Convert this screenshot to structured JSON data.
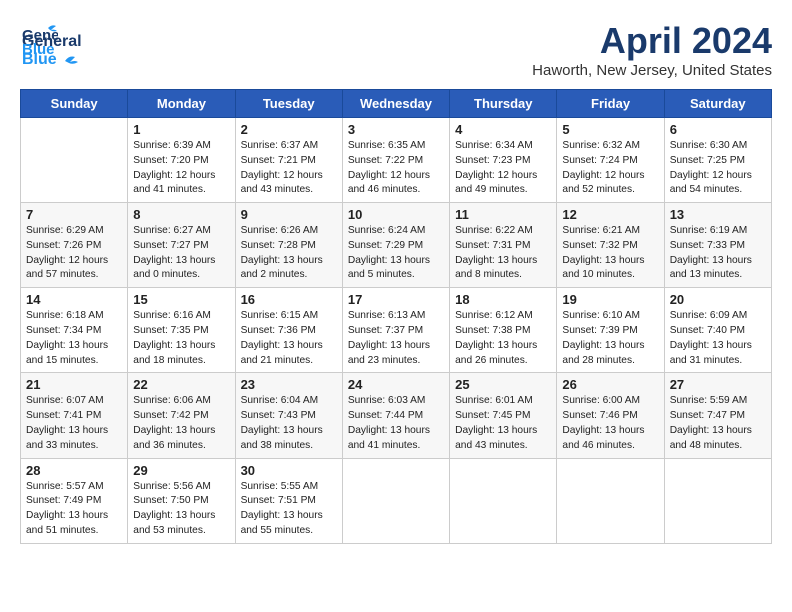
{
  "header": {
    "logo_general": "General",
    "logo_blue": "Blue",
    "month_title": "April 2024",
    "location": "Haworth, New Jersey, United States"
  },
  "columns": [
    "Sunday",
    "Monday",
    "Tuesday",
    "Wednesday",
    "Thursday",
    "Friday",
    "Saturday"
  ],
  "weeks": [
    [
      {
        "day": "",
        "info": ""
      },
      {
        "day": "1",
        "info": "Sunrise: 6:39 AM\nSunset: 7:20 PM\nDaylight: 12 hours\nand 41 minutes."
      },
      {
        "day": "2",
        "info": "Sunrise: 6:37 AM\nSunset: 7:21 PM\nDaylight: 12 hours\nand 43 minutes."
      },
      {
        "day": "3",
        "info": "Sunrise: 6:35 AM\nSunset: 7:22 PM\nDaylight: 12 hours\nand 46 minutes."
      },
      {
        "day": "4",
        "info": "Sunrise: 6:34 AM\nSunset: 7:23 PM\nDaylight: 12 hours\nand 49 minutes."
      },
      {
        "day": "5",
        "info": "Sunrise: 6:32 AM\nSunset: 7:24 PM\nDaylight: 12 hours\nand 52 minutes."
      },
      {
        "day": "6",
        "info": "Sunrise: 6:30 AM\nSunset: 7:25 PM\nDaylight: 12 hours\nand 54 minutes."
      }
    ],
    [
      {
        "day": "7",
        "info": "Sunrise: 6:29 AM\nSunset: 7:26 PM\nDaylight: 12 hours\nand 57 minutes."
      },
      {
        "day": "8",
        "info": "Sunrise: 6:27 AM\nSunset: 7:27 PM\nDaylight: 13 hours\nand 0 minutes."
      },
      {
        "day": "9",
        "info": "Sunrise: 6:26 AM\nSunset: 7:28 PM\nDaylight: 13 hours\nand 2 minutes."
      },
      {
        "day": "10",
        "info": "Sunrise: 6:24 AM\nSunset: 7:29 PM\nDaylight: 13 hours\nand 5 minutes."
      },
      {
        "day": "11",
        "info": "Sunrise: 6:22 AM\nSunset: 7:31 PM\nDaylight: 13 hours\nand 8 minutes."
      },
      {
        "day": "12",
        "info": "Sunrise: 6:21 AM\nSunset: 7:32 PM\nDaylight: 13 hours\nand 10 minutes."
      },
      {
        "day": "13",
        "info": "Sunrise: 6:19 AM\nSunset: 7:33 PM\nDaylight: 13 hours\nand 13 minutes."
      }
    ],
    [
      {
        "day": "14",
        "info": "Sunrise: 6:18 AM\nSunset: 7:34 PM\nDaylight: 13 hours\nand 15 minutes."
      },
      {
        "day": "15",
        "info": "Sunrise: 6:16 AM\nSunset: 7:35 PM\nDaylight: 13 hours\nand 18 minutes."
      },
      {
        "day": "16",
        "info": "Sunrise: 6:15 AM\nSunset: 7:36 PM\nDaylight: 13 hours\nand 21 minutes."
      },
      {
        "day": "17",
        "info": "Sunrise: 6:13 AM\nSunset: 7:37 PM\nDaylight: 13 hours\nand 23 minutes."
      },
      {
        "day": "18",
        "info": "Sunrise: 6:12 AM\nSunset: 7:38 PM\nDaylight: 13 hours\nand 26 minutes."
      },
      {
        "day": "19",
        "info": "Sunrise: 6:10 AM\nSunset: 7:39 PM\nDaylight: 13 hours\nand 28 minutes."
      },
      {
        "day": "20",
        "info": "Sunrise: 6:09 AM\nSunset: 7:40 PM\nDaylight: 13 hours\nand 31 minutes."
      }
    ],
    [
      {
        "day": "21",
        "info": "Sunrise: 6:07 AM\nSunset: 7:41 PM\nDaylight: 13 hours\nand 33 minutes."
      },
      {
        "day": "22",
        "info": "Sunrise: 6:06 AM\nSunset: 7:42 PM\nDaylight: 13 hours\nand 36 minutes."
      },
      {
        "day": "23",
        "info": "Sunrise: 6:04 AM\nSunset: 7:43 PM\nDaylight: 13 hours\nand 38 minutes."
      },
      {
        "day": "24",
        "info": "Sunrise: 6:03 AM\nSunset: 7:44 PM\nDaylight: 13 hours\nand 41 minutes."
      },
      {
        "day": "25",
        "info": "Sunrise: 6:01 AM\nSunset: 7:45 PM\nDaylight: 13 hours\nand 43 minutes."
      },
      {
        "day": "26",
        "info": "Sunrise: 6:00 AM\nSunset: 7:46 PM\nDaylight: 13 hours\nand 46 minutes."
      },
      {
        "day": "27",
        "info": "Sunrise: 5:59 AM\nSunset: 7:47 PM\nDaylight: 13 hours\nand 48 minutes."
      }
    ],
    [
      {
        "day": "28",
        "info": "Sunrise: 5:57 AM\nSunset: 7:49 PM\nDaylight: 13 hours\nand 51 minutes."
      },
      {
        "day": "29",
        "info": "Sunrise: 5:56 AM\nSunset: 7:50 PM\nDaylight: 13 hours\nand 53 minutes."
      },
      {
        "day": "30",
        "info": "Sunrise: 5:55 AM\nSunset: 7:51 PM\nDaylight: 13 hours\nand 55 minutes."
      },
      {
        "day": "",
        "info": ""
      },
      {
        "day": "",
        "info": ""
      },
      {
        "day": "",
        "info": ""
      },
      {
        "day": "",
        "info": ""
      }
    ]
  ]
}
